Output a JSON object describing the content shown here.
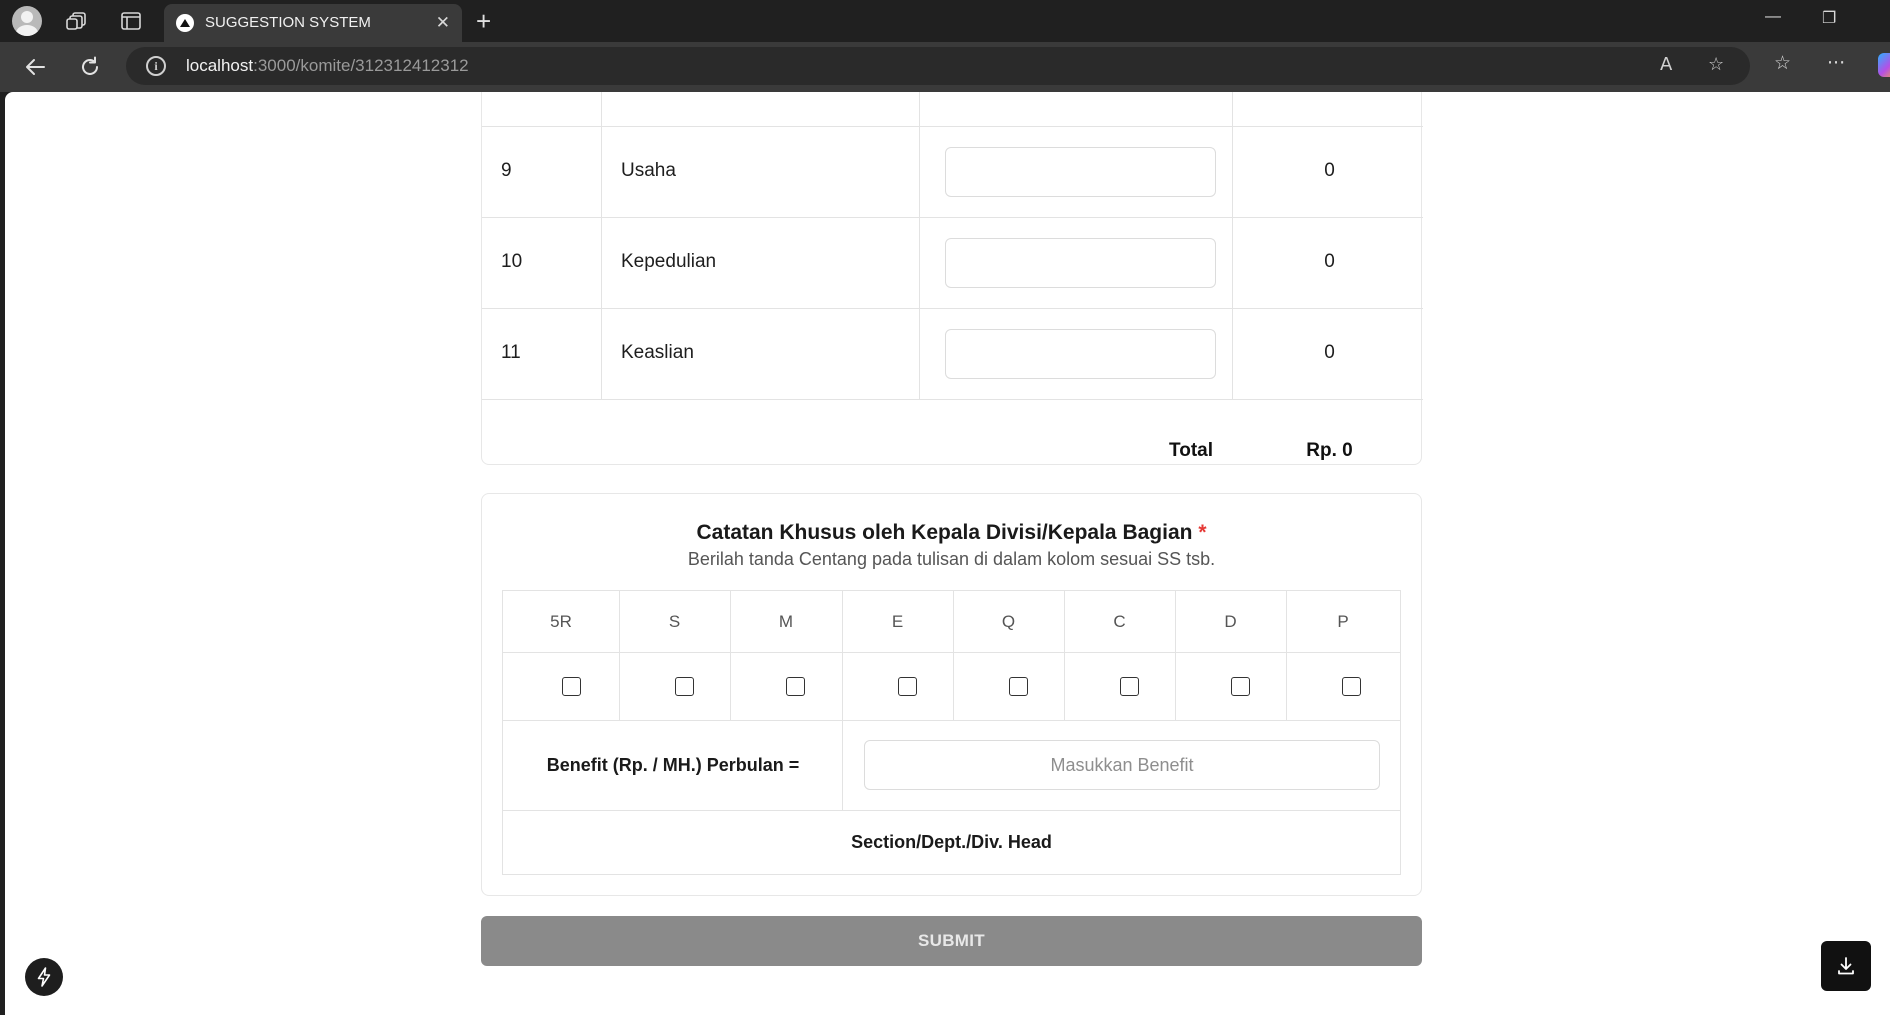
{
  "browser": {
    "tab_title": "SUGGESTION SYSTEM",
    "tab_close": "✕",
    "new_tab": "+",
    "url_host": "localhost",
    "url_rest": ":3000/komite/312312412312",
    "window_controls": {
      "minimize": "—",
      "restore": "❐",
      "close": "✕"
    },
    "read_aloud": "A",
    "more": "···"
  },
  "score_table": {
    "rows": [
      {
        "no": "9",
        "criteria": "Usaha",
        "value": "",
        "score": "0"
      },
      {
        "no": "10",
        "criteria": "Kepedulian",
        "value": "",
        "score": "0"
      },
      {
        "no": "11",
        "criteria": "Keaslian",
        "value": "",
        "score": "0"
      }
    ],
    "total_label": "Total",
    "total_value": "Rp. 0"
  },
  "notes": {
    "title": "Catatan Khusus oleh Kepala Divisi/Kepala Bagian",
    "required_mark": "*",
    "subtitle": "Berilah tanda Centang pada tulisan di dalam kolom sesuai SS tsb.",
    "categories": [
      "5R",
      "S",
      "M",
      "E",
      "Q",
      "C",
      "D",
      "P"
    ],
    "benefit_label": "Benefit (Rp. / MH.) Perbulan =",
    "benefit_placeholder": "Masukkan Benefit",
    "signature_label": "Section/Dept./Div. Head"
  },
  "submit_label": "SUBMIT",
  "icons": {
    "profile": "profile-icon",
    "workspaces": "workspaces-icon",
    "tab_actions": "tab-actions-icon",
    "back": "back-arrow-icon",
    "reload": "reload-icon",
    "info": "info-icon",
    "favorite": "star-icon",
    "favorites_list": "favorites-list-icon",
    "lightning": "lightning-icon",
    "download": "download-icon"
  }
}
